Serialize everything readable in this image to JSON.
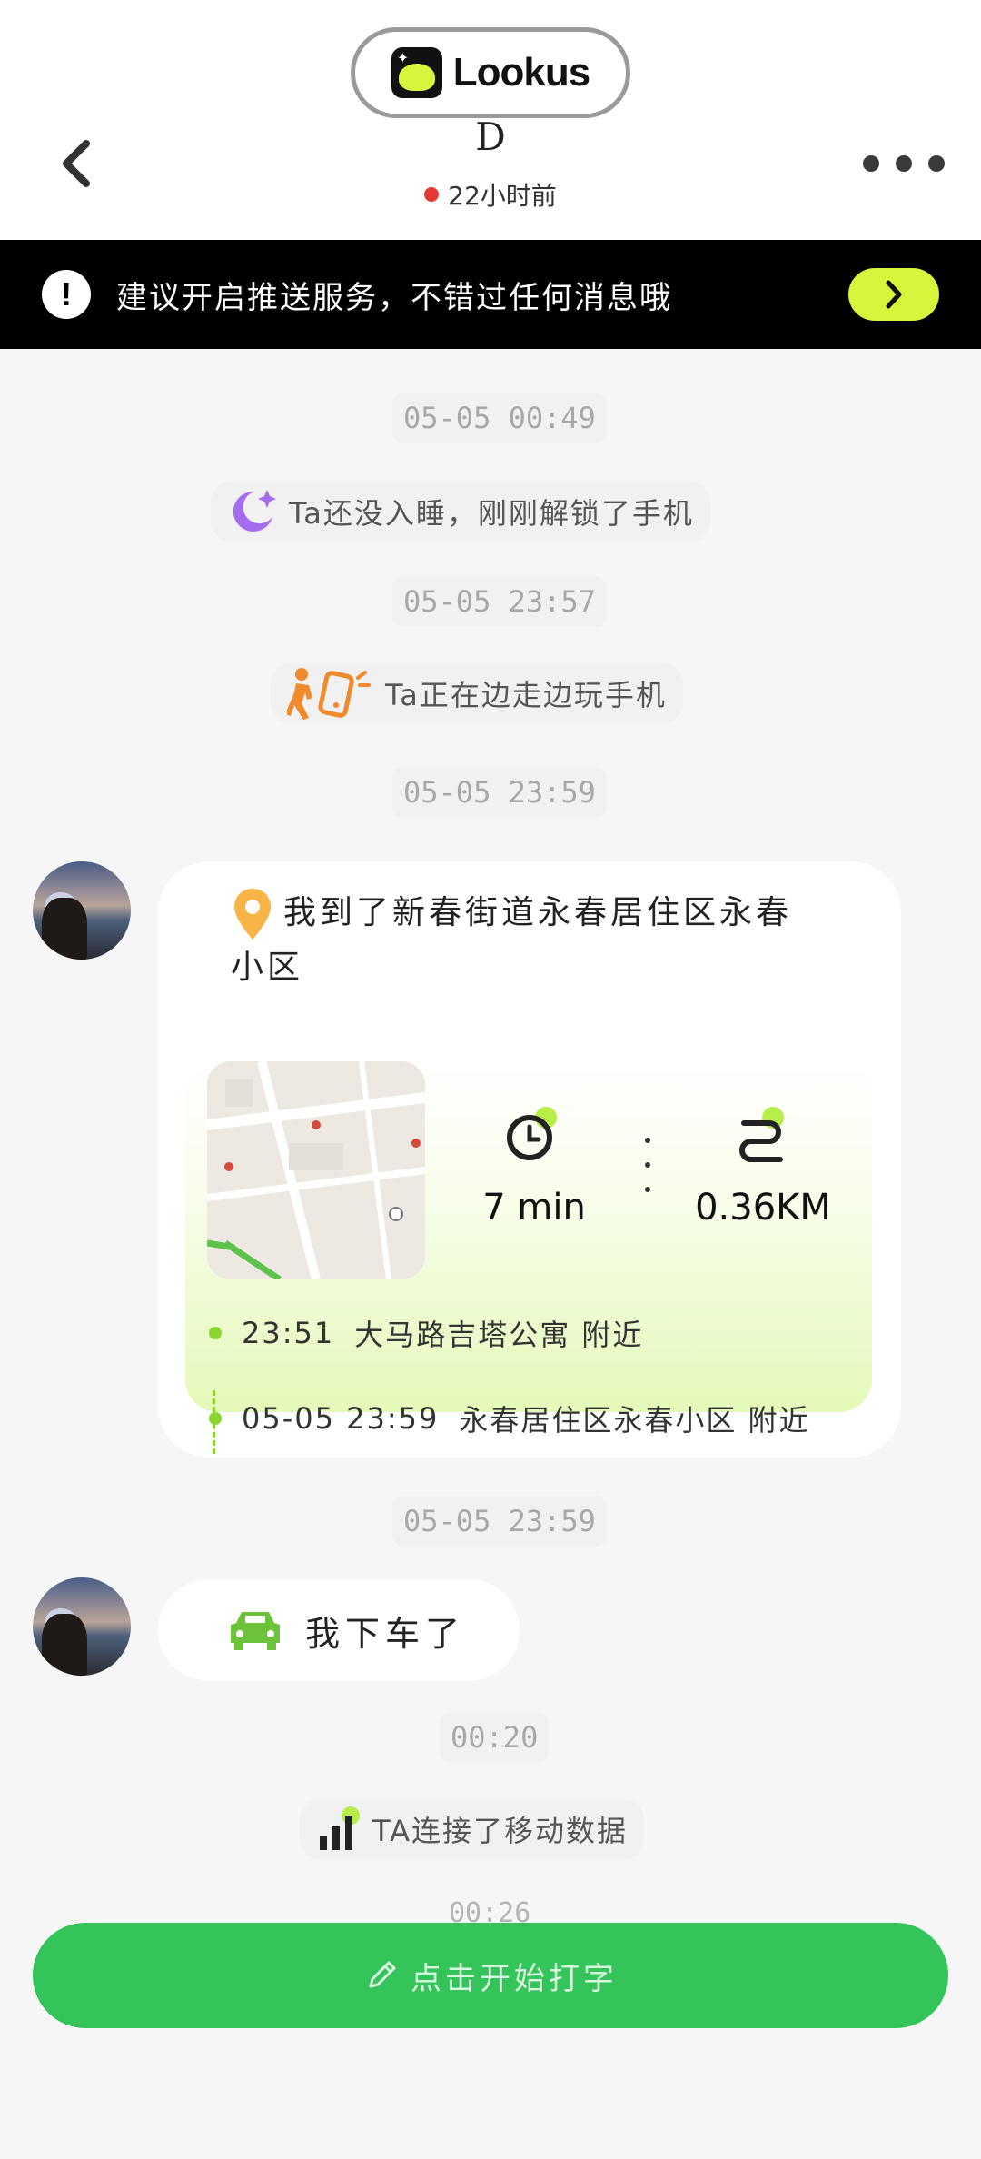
{
  "header": {
    "app_name": "Lookus",
    "contact_name": "D",
    "last_seen": "22小时前"
  },
  "push_banner": {
    "text": "建议开启推送服务，不错过任何消息哦"
  },
  "timeline": {
    "t1": "05-05 00:49",
    "event1": "Ta还没入睡，刚刚解锁了手机",
    "t2": "05-05 23:57",
    "event2": "Ta正在边走边玩手机",
    "t3": "05-05 23:59",
    "location_card": {
      "title": "我到了新春街道永春居住区永春小区",
      "duration": "7 min",
      "distance": "0.36KM",
      "route_start": {
        "time": "23:51",
        "place": "大马路吉塔公寓 附近"
      },
      "route_end": {
        "time": "05-05 23:59",
        "place": "永春居住区永春小区 附近"
      }
    },
    "t4": "05-05 23:59",
    "car_message": "我下车了",
    "t5": "00:20",
    "event3": "TA连接了移动数据",
    "t6": "00:26"
  },
  "input": {
    "label": "点击开始打字"
  },
  "colors": {
    "accent_green": "#35c45a",
    "lime": "#d6f53b",
    "status_red": "#e53935"
  }
}
